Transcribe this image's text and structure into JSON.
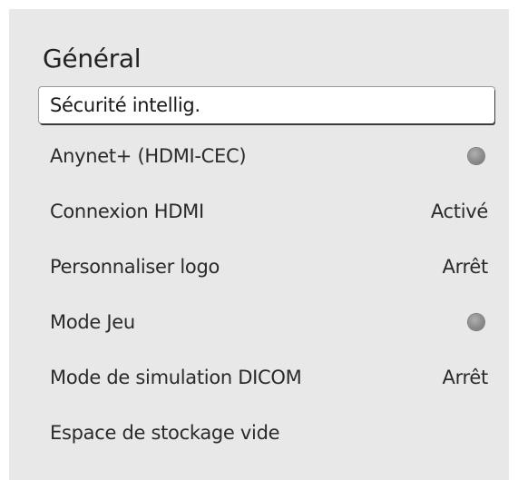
{
  "panel": {
    "title": "Général"
  },
  "menu": {
    "items": [
      {
        "label": "Sécurité intellig.",
        "value": "",
        "control": "none",
        "focused": true
      },
      {
        "label": "Anynet+ (HDMI-CEC)",
        "value": "",
        "control": "toggle-off"
      },
      {
        "label": "Connexion HDMI",
        "value": "Activé",
        "control": "value"
      },
      {
        "label": "Personnaliser logo",
        "value": "Arrêt",
        "control": "value"
      },
      {
        "label": "Mode Jeu",
        "value": "",
        "control": "toggle-off"
      },
      {
        "label": "Mode de simulation DICOM",
        "value": "Arrêt",
        "control": "value"
      },
      {
        "label": "Espace de stockage vide",
        "value": "",
        "control": "none"
      }
    ]
  },
  "colors": {
    "panel_background": "#e8e8e8",
    "focus_background": "#ffffff",
    "text": "#222222",
    "toggle_off": "#8c8c8c"
  }
}
